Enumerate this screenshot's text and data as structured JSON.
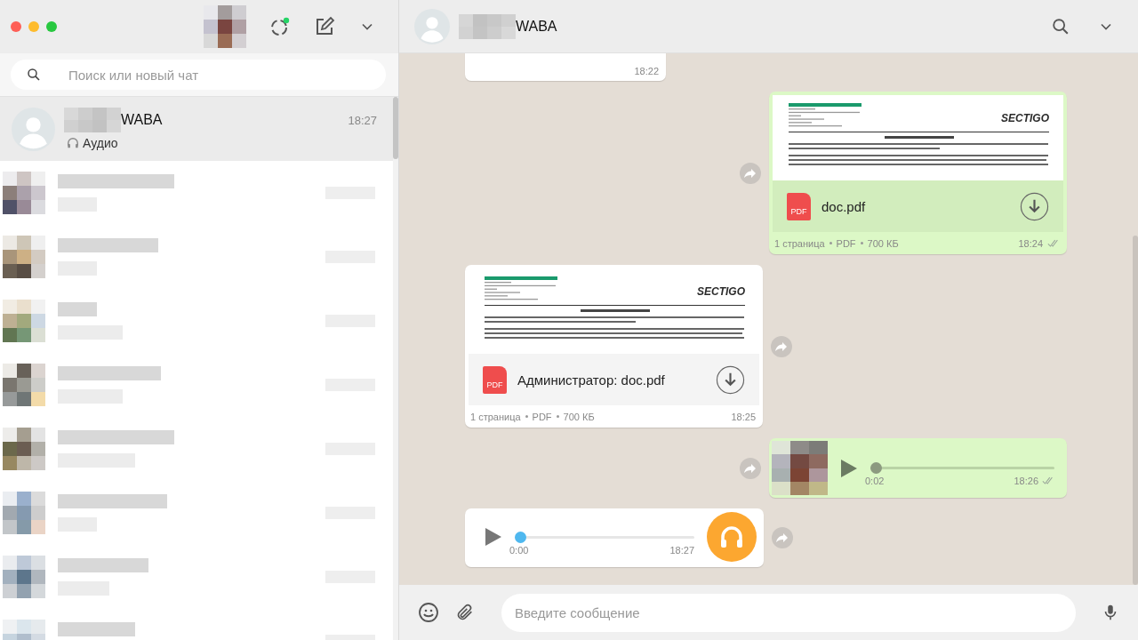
{
  "sidebar": {
    "search": {
      "placeholder": "Поиск или новый чат"
    },
    "chats": [
      {
        "name": "WABA",
        "preview": "Аудио",
        "time": "18:27",
        "selected": true
      }
    ]
  },
  "conversation": {
    "title": "WABA",
    "messages": [
      {
        "kind": "text",
        "outgoing": false,
        "time": "18:22"
      },
      {
        "kind": "document",
        "outgoing": true,
        "ticks": true,
        "preview": {
          "logo": "SECTIGO"
        },
        "file_icon": "PDF",
        "filename": "doc.pdf",
        "pages": "1 страница",
        "type": "PDF",
        "size": "700 КБ",
        "time": "18:24"
      },
      {
        "kind": "document",
        "outgoing": false,
        "ticks": false,
        "preview": {
          "logo": "SECTIGO"
        },
        "file_icon": "PDF",
        "filename": "Администратор: doc.pdf",
        "pages": "1 страница",
        "type": "PDF",
        "size": "700 КБ",
        "time": "18:25"
      },
      {
        "kind": "voice",
        "outgoing": true,
        "ticks": true,
        "level": 0,
        "duration": "0:02",
        "time": "18:26"
      },
      {
        "kind": "voice",
        "outgoing": false,
        "ticks": false,
        "level": 0,
        "duration": "0:00",
        "time": "18:27"
      }
    ]
  },
  "composer": {
    "placeholder": "Введите сообщение"
  }
}
